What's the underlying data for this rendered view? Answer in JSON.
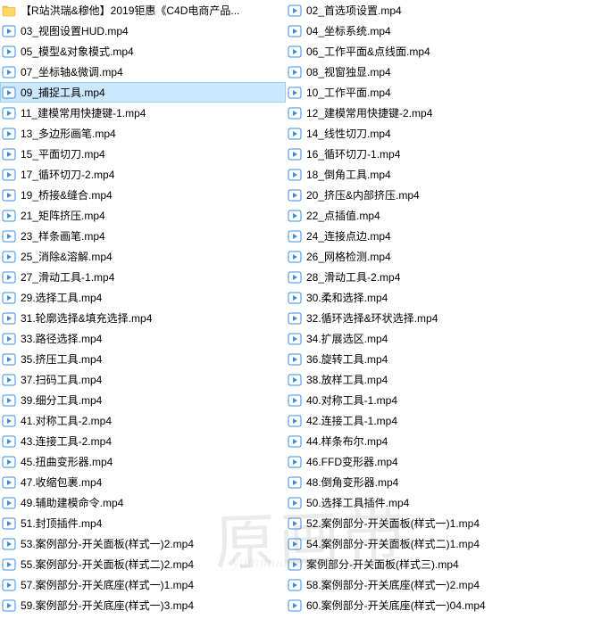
{
  "selected_index": 4,
  "watermark_main": "原画带",
  "watermark_sub": "yuanhuadai.com",
  "files": [
    {
      "type": "folder",
      "name": "【R站洪瑞&穆他】2019钜惠《C4D电商产品..."
    },
    {
      "type": "video",
      "name": "03_视图设置HUD.mp4"
    },
    {
      "type": "video",
      "name": "05_模型&对象模式.mp4"
    },
    {
      "type": "video",
      "name": "07_坐标轴&微调.mp4"
    },
    {
      "type": "video",
      "name": "09_捕捉工具.mp4"
    },
    {
      "type": "video",
      "name": "11_建模常用快捷键-1.mp4"
    },
    {
      "type": "video",
      "name": "13_多边形画笔.mp4"
    },
    {
      "type": "video",
      "name": "15_平面切刀.mp4"
    },
    {
      "type": "video",
      "name": "17_循环切刀-2.mp4"
    },
    {
      "type": "video",
      "name": "19_桥接&缝合.mp4"
    },
    {
      "type": "video",
      "name": "21_矩阵挤压.mp4"
    },
    {
      "type": "video",
      "name": "23_样条画笔.mp4"
    },
    {
      "type": "video",
      "name": "25_消除&溶解.mp4"
    },
    {
      "type": "video",
      "name": "27_滑动工具-1.mp4"
    },
    {
      "type": "video",
      "name": "29.选择工具.mp4"
    },
    {
      "type": "video",
      "name": "31.轮廓选择&填充选择.mp4"
    },
    {
      "type": "video",
      "name": "33.路径选择.mp4"
    },
    {
      "type": "video",
      "name": "35.挤压工具.mp4"
    },
    {
      "type": "video",
      "name": "37.扫码工具.mp4"
    },
    {
      "type": "video",
      "name": "39.细分工具.mp4"
    },
    {
      "type": "video",
      "name": "41.对称工具-2.mp4"
    },
    {
      "type": "video",
      "name": "43.连接工具-2.mp4"
    },
    {
      "type": "video",
      "name": "45.扭曲变形器.mp4"
    },
    {
      "type": "video",
      "name": "47.收缩包裹.mp4"
    },
    {
      "type": "video",
      "name": "49.辅助建模命令.mp4"
    },
    {
      "type": "video",
      "name": "51.封顶插件.mp4"
    },
    {
      "type": "video",
      "name": "53.案例部分-开关面板(样式一)2.mp4"
    },
    {
      "type": "video",
      "name": "55.案例部分-开关面板(样式二)2.mp4"
    },
    {
      "type": "video",
      "name": "57.案例部分-开关底座(样式一)1.mp4"
    },
    {
      "type": "video",
      "name": "59.案例部分-开关底座(样式一)3.mp4"
    },
    {
      "type": "video",
      "name": "02_首选项设置.mp4"
    },
    {
      "type": "video",
      "name": "04_坐标系统.mp4"
    },
    {
      "type": "video",
      "name": "06_工作平面&点线面.mp4"
    },
    {
      "type": "video",
      "name": "08_视窗独显.mp4"
    },
    {
      "type": "video",
      "name": "10_工作平面.mp4"
    },
    {
      "type": "video",
      "name": "12_建模常用快捷键-2.mp4"
    },
    {
      "type": "video",
      "name": "14_线性切刀.mp4"
    },
    {
      "type": "video",
      "name": "16_循环切刀-1.mp4"
    },
    {
      "type": "video",
      "name": "18_倒角工具.mp4"
    },
    {
      "type": "video",
      "name": "20_挤压&内部挤压.mp4"
    },
    {
      "type": "video",
      "name": "22_点插值.mp4"
    },
    {
      "type": "video",
      "name": "24_连接点边.mp4"
    },
    {
      "type": "video",
      "name": "26_网格检测.mp4"
    },
    {
      "type": "video",
      "name": "28_滑动工具-2.mp4"
    },
    {
      "type": "video",
      "name": "30.柔和选择.mp4"
    },
    {
      "type": "video",
      "name": "32.循环选择&环状选择.mp4"
    },
    {
      "type": "video",
      "name": "34.扩展选区.mp4"
    },
    {
      "type": "video",
      "name": "36.旋转工具.mp4"
    },
    {
      "type": "video",
      "name": "38.放样工具.mp4"
    },
    {
      "type": "video",
      "name": "40.对称工具-1.mp4"
    },
    {
      "type": "video",
      "name": "42.连接工具-1.mp4"
    },
    {
      "type": "video",
      "name": "44.样条布尔.mp4"
    },
    {
      "type": "video",
      "name": "46.FFD变形器.mp4"
    },
    {
      "type": "video",
      "name": "48.倒角变形器.mp4"
    },
    {
      "type": "video",
      "name": "50.选择工具插件.mp4"
    },
    {
      "type": "video",
      "name": "52.案例部分-开关面板(样式一)1.mp4"
    },
    {
      "type": "video",
      "name": "54.案例部分-开关面板(样式二)1.mp4"
    },
    {
      "type": "video",
      "name": "案例部分-开关面板(样式三).mp4"
    },
    {
      "type": "video",
      "name": "58.案例部分-开关底座(样式一)2.mp4"
    },
    {
      "type": "video",
      "name": "60.案例部分-开关底座(样式一)04.mp4"
    }
  ]
}
